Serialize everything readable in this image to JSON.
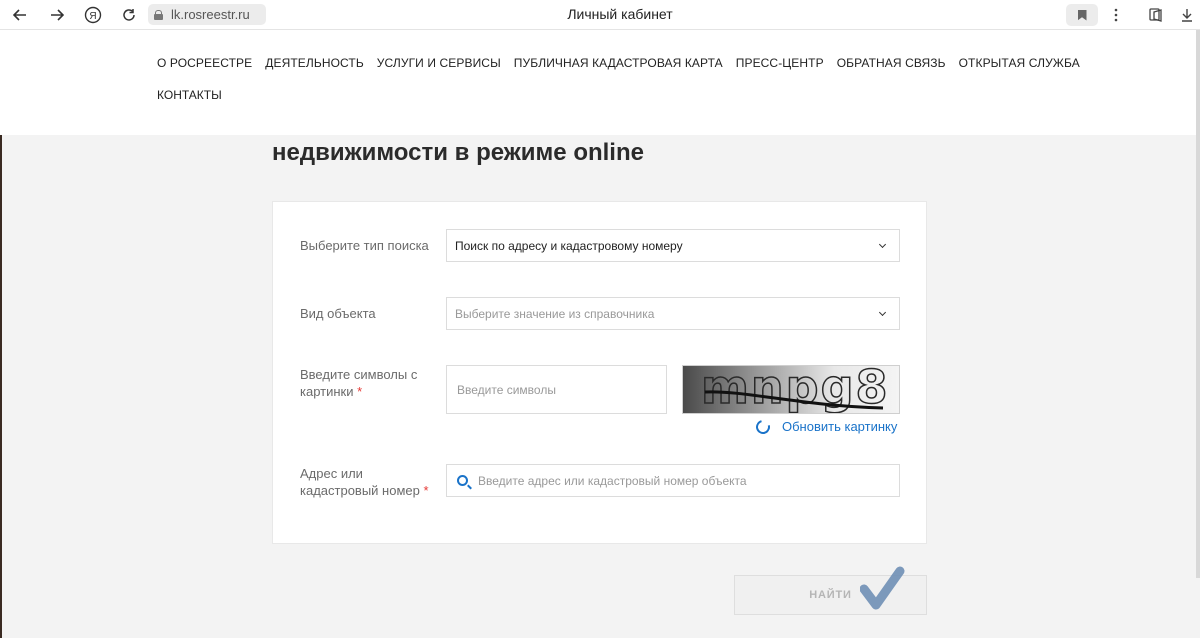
{
  "browser": {
    "url": "lk.rosreestr.ru",
    "tab_title": "Личный кабинет",
    "yandex_glyph": "Я"
  },
  "nav": {
    "items": [
      "О РОСРЕЕСТРЕ",
      "ДЕЯТЕЛЬНОСТЬ",
      "УСЛУГИ И СЕРВИСЫ",
      "ПУБЛИЧНАЯ КАДАСТРОВАЯ КАРТА",
      "ПРЕСС-ЦЕНТР",
      "ОБРАТНАЯ СВЯЗЬ",
      "ОТКРЫТАЯ СЛУЖБА"
    ],
    "second_row": "КОНТАКТЫ"
  },
  "heading": "недвижимости в режиме online",
  "form": {
    "search_type": {
      "label": "Выберите тип поиска",
      "value": "Поиск по адресу и кадастровому номеру"
    },
    "object_type": {
      "label": "Вид объекта",
      "placeholder": "Выберите значение из справочника"
    },
    "captcha": {
      "label_line1": "Введите символы с",
      "label_line2": "картинки",
      "required_mark": "*",
      "placeholder": "Введите символы",
      "image_text": "mnpg8",
      "refresh_label": "Обновить картинку"
    },
    "address": {
      "label_line1": "Адрес или",
      "label_line2": "кадастровый номер",
      "required_mark": "*",
      "placeholder": "Введите адрес или кадастровый номер объекта"
    },
    "submit_label": "НАЙТИ"
  },
  "colors": {
    "accent": "#1a73c9",
    "required": "#e53935",
    "checkmark": "#6f8fb5"
  },
  "icons": [
    "back-arrow-icon",
    "forward-arrow-icon",
    "yandex-icon",
    "reload-icon",
    "lock-icon",
    "bookmark-icon",
    "menu-dots-icon",
    "collections-icon",
    "download-icon",
    "chevron-down-icon",
    "refresh-icon",
    "search-icon",
    "checkmark-icon"
  ]
}
